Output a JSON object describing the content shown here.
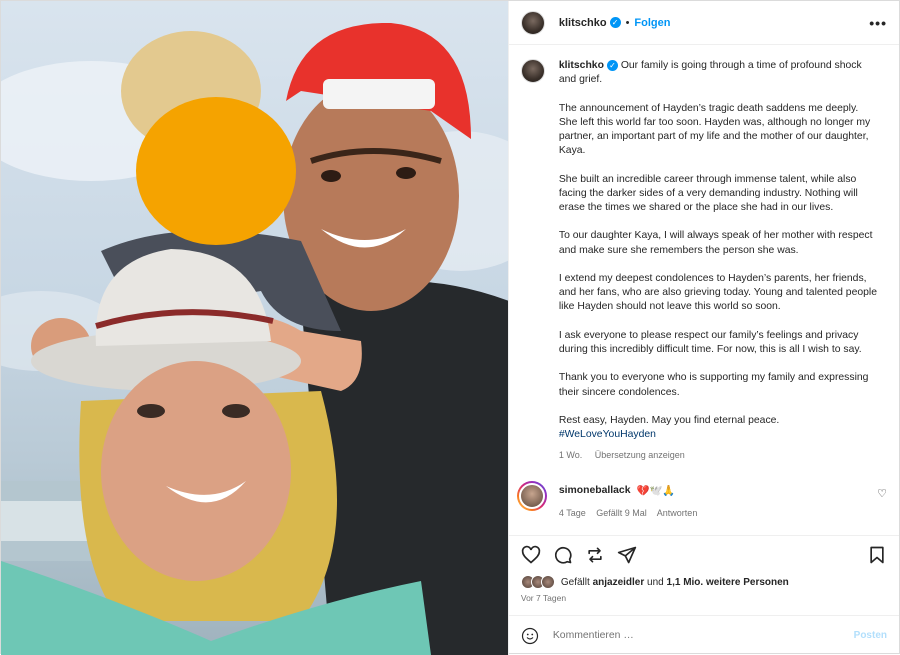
{
  "post": {
    "username": "klitschko",
    "follow_label": "Folgen",
    "dot": "•",
    "more": "•••",
    "photo_alt": "Photo"
  },
  "caption": {
    "p1": "Our family is going through a time of profound shock and grief.",
    "p2": "The announcement of Hayden’s tragic death saddens me deeply. She left this world far too soon. Hayden was, although no longer my partner, an important part of my life and the mother of our daughter, Kaya.",
    "p3": "She built an incredible career through immense talent, while also facing the darker sides of a very demanding industry. Nothing will erase the times we shared or the place she had in our lives.",
    "p4": "To our daughter Kaya, I will always speak of her mother with respect and make sure she remembers the person she was.",
    "p5": "I extend my deepest condolences to Hayden’s parents, her friends, and her fans, who are also grieving today. Young and talented people like Hayden should not leave this world so soon.",
    "p6": "I ask everyone to please respect our family’s feelings and privacy during this incredibly difficult time. For now, this is all I wish to say.",
    "p7": "Thank you to everyone who is supporting my family and expressing their sincere condolences.",
    "p8": "Rest easy, Hayden. May you find eternal peace.",
    "hashtag": "#WeLoveYouHayden",
    "time": "1 Wo.",
    "translate": "Übersetzung anzeigen"
  },
  "comment": {
    "username": "simoneballack",
    "emojis": "💔🕊️🙏",
    "time": "4 Tage",
    "likes": "Gefällt 9 Mal",
    "reply": "Antworten"
  },
  "likes": {
    "prefix": "Gefällt",
    "user": "anjazeidler",
    "and": "und",
    "others": "1,1 Mio. weitere Personen"
  },
  "date": "Vor 7 Tagen",
  "compose": {
    "placeholder": "Kommentieren …",
    "post_label": "Posten"
  },
  "colors": {
    "accent": "#0095f6",
    "hashtag": "#00376b",
    "censor": "#f5a300"
  },
  "icons": [
    "heart-icon",
    "comment-icon",
    "repost-icon",
    "share-icon",
    "bookmark-icon",
    "emoji-icon",
    "verified-icon",
    "more-icon"
  ]
}
